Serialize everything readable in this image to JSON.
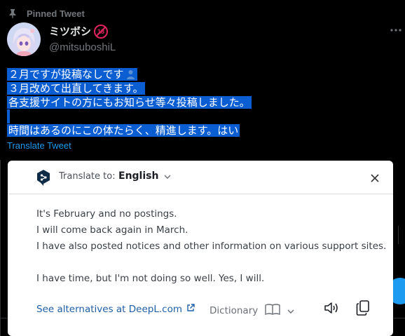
{
  "tweet": {
    "pinned_label": "Pinned Tweet",
    "display_name": "ミツボシ",
    "age_badge": "18",
    "handle": "@mitsuboshiL",
    "lines": [
      "２月ですが投稿なしです",
      "３月改めて出直してきます。",
      "各支援サイトの方にもお知らせ等々投稿しました。",
      "",
      "時間はあるのにこの体たらく、精進します。はい"
    ],
    "translate_link": "Translate Tweet"
  },
  "popup": {
    "translate_to_label": "Translate to:",
    "language": "English",
    "translation_lines": [
      "It's February and no postings.",
      "I will come back again in March.",
      "I have also posted notices and other information on various support sites.",
      "",
      "I have time, but I'm not doing so well. Yes, I will."
    ],
    "alternatives_link": "See alternatives at DeepL.com",
    "dictionary_label": "Dictionary"
  },
  "colors": {
    "background": "#000000",
    "selection": "#0a5ed2",
    "link": "#1d9bf0",
    "deepl_link": "#1f5fa8",
    "deepl_navy": "#0f2b46"
  },
  "icons": [
    "pin-icon",
    "avatar",
    "age-restriction-icon",
    "more-icon",
    "person-emoji-icon",
    "deepl-logo-icon",
    "chevron-down-icon",
    "close-icon",
    "external-link-icon",
    "book-icon",
    "speaker-icon",
    "copy-icon",
    "drag-handle-icon"
  ]
}
